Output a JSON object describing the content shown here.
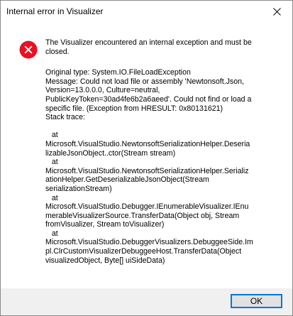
{
  "window": {
    "title": "Internal error in Visualizer",
    "close_icon": "close-icon"
  },
  "icon": {
    "name": "error-icon",
    "color": "#e81123"
  },
  "message": {
    "main_lines": [
      "The Visualizer encountered an internal exception and must be",
      "closed."
    ],
    "detail_lines": [
      "Original type: System.IO.FileLoadException",
      "Message: Could not load file or assembly 'Newtonsoft.Json,",
      "Version=13.0.0.0, Culture=neutral,",
      "PublicKeyToken=30ad4fe6b2a6aeed'. Could not find or load a",
      "specific file. (Exception from HRESULT: 0x80131621)",
      "Stack trace:",
      "",
      "   at",
      "Microsoft.VisualStudio.NewtonsoftSerializationHelper.Deseria",
      "lizableJsonObject..ctor(Stream stream)",
      "   at",
      "Microsoft.VisualStudio.NewtonsoftSerializationHelper.Serializ",
      "ationHelper.GetDeserializableJsonObject(Stream",
      "serializationStream)",
      "   at",
      "Microsoft.VisualStudio.Debugger.IEnumerableVisualizer.IEnu",
      "merableVisualizerSource.TransferData(Object obj, Stream",
      "fromVisualizer, Stream toVisualizer)",
      "   at",
      "Microsoft.VisualStudio.DebuggerVisualizers.DebuggeeSide.Im",
      "pl.ClrCustomVisualizerDebuggeeHost.TransferData(Object",
      "visualizedObject, Byte[] uiSideData)"
    ]
  },
  "footer": {
    "ok_label": "OK"
  }
}
